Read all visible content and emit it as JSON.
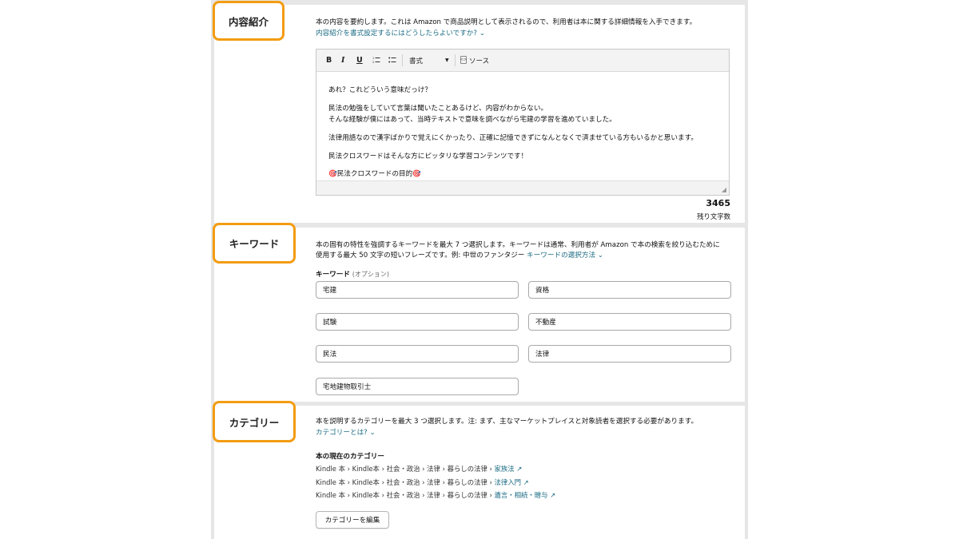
{
  "description": {
    "tag_label": "内容紹介",
    "help_text": "本の内容を要約します。これは Amazon で商品説明として表示されるので、利用者は本に関する詳細情報を入手できます。",
    "format_link": "内容紹介を書式設定するにはどうしたらよいですか? ⌄",
    "toolbar": {
      "bold": "B",
      "italic": "I",
      "underline": "U",
      "format_select": "書式",
      "source_label": "ソース"
    },
    "body_lines": [
      "あれ？これどういう意味だっけ？",
      "民法の勉強をしていて言葉は聞いたことあるけど、内容がわからない。",
      "そんな経験が僕にはあって、当時テキストで意味を調べながら宅建の学習を進めていました。",
      "法律用語なので漢字ばかりで覚えにくかったり、正確に記憶できずになんとなくで済ませている方もいるかと思います。",
      "民法クロスワードはそんな方にピッタリな学習コンテンツです！",
      "🎯民法クロスワードの目的🎯"
    ],
    "remaining_count": "3465",
    "remaining_label": "残り文字数"
  },
  "keywords": {
    "tag_label": "キーワード",
    "help_line1": "本の固有の特性を強調するキーワードを最大 7 つ選択します。キーワードは通常、利用者が Amazon で本の検索を絞り込むために",
    "help_line2_prefix": "使用する最大 50 文字の短いフレーズです。例: 中世のファンタジー",
    "help_link": "キーワードの選択方法 ⌄",
    "field_label": "キーワード",
    "field_optional": "(オプション)",
    "values": [
      "宅建",
      "資格",
      "試験",
      "不動産",
      "民法",
      "法律",
      "宅地建物取引士"
    ]
  },
  "category": {
    "tag_label": "カテゴリー",
    "help_text": "本を説明するカテゴリーを最大 3 つ選択します。注: まず、主なマーケットプレイスと対象読者を選択する必要があります。",
    "what_link": "カテゴリーとは? ⌄",
    "current_heading": "本の現在のカテゴリー",
    "paths": [
      {
        "prefix": "Kindle 本 › Kindle本 › 社会・政治 › 法律 › 暮らしの法律 › ",
        "leaf": "家族法 ↗"
      },
      {
        "prefix": "Kindle 本 › Kindle本 › 社会・政治 › 法律 › 暮らしの法律 › ",
        "leaf": "法律入門 ↗"
      },
      {
        "prefix": "Kindle 本 › Kindle本 › 社会・政治 › 法律 › 暮らしの法律 › ",
        "leaf": "遺言・相続・贈与 ↗"
      }
    ],
    "edit_button": "カテゴリーを編集"
  },
  "colors": {
    "highlight_border": "#f39c12",
    "link": "#1a6b83",
    "panel_gap": "#e6e6e6"
  }
}
